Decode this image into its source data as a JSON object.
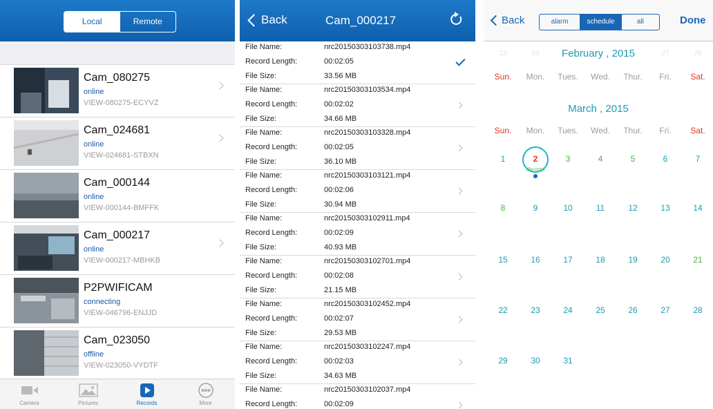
{
  "colors": {
    "nav_blue": "#1a66b6",
    "teal": "#1a9bb3",
    "red": "#d9332a",
    "green": "#3cb83c",
    "gray": "#9a9a9a"
  },
  "screen1": {
    "segment": {
      "local": "Local",
      "remote": "Remote",
      "selected": "Local"
    },
    "cameras": [
      {
        "name": "Cam_080275",
        "status": "online",
        "id": "VIEW-080275-ECYVZ",
        "has_chevron": true
      },
      {
        "name": "Cam_024681",
        "status": "online",
        "id": "VIEW-024681-STBXN",
        "has_chevron": true
      },
      {
        "name": "Cam_000144",
        "status": "online",
        "id": "VIEW-000144-BMFFK",
        "has_chevron": false
      },
      {
        "name": "Cam_000217",
        "status": "online",
        "id": "VIEW-000217-MBHKB",
        "has_chevron": true
      },
      {
        "name": "P2PWIFICAM",
        "status": "connecting",
        "id": "VIEW-046796-ENJJD",
        "has_chevron": false
      },
      {
        "name": "Cam_023050",
        "status": "offline",
        "id": "VIEW-023050-VYDTF",
        "has_chevron": false
      }
    ],
    "tabs": [
      {
        "label": "Camera",
        "icon": "camera-icon"
      },
      {
        "label": "Pictures",
        "icon": "pictures-icon"
      },
      {
        "label": "Records",
        "icon": "records-icon",
        "active": true
      },
      {
        "label": "More",
        "icon": "more-icon"
      }
    ]
  },
  "screen2": {
    "back": "Back",
    "title": "Cam_000217",
    "labels": {
      "file_name": "File Name:",
      "record_length": "Record Length:",
      "file_size": "File Size:"
    },
    "records": [
      {
        "file": "nrc20150303103738.mp4",
        "length": "00:02:05",
        "size": "33.56 MB",
        "checked": true
      },
      {
        "file": "nrc20150303103534.mp4",
        "length": "00:02:02",
        "size": "34.66 MB"
      },
      {
        "file": "nrc20150303103328.mp4",
        "length": "00:02:05",
        "size": "36.10 MB"
      },
      {
        "file": "nrc20150303103121.mp4",
        "length": "00:02:06",
        "size": "30.94 MB"
      },
      {
        "file": "nrc20150303102911.mp4",
        "length": "00:02:09",
        "size": "40.93 MB"
      },
      {
        "file": "nrc20150303102701.mp4",
        "length": "00:02:08",
        "size": "21.15 MB"
      },
      {
        "file": "nrc20150303102452.mp4",
        "length": "00:02:07",
        "size": "29.53 MB"
      },
      {
        "file": "nrc20150303102247.mp4",
        "length": "00:02:03",
        "size": "34.63 MB"
      },
      {
        "file": "nrc20150303102037.mp4",
        "length": "00:02:09",
        "size": ""
      }
    ]
  },
  "screen3": {
    "back": "Back",
    "segments": [
      "alarm",
      "schedule",
      "all"
    ],
    "selected_segment": "schedule",
    "done": "Done",
    "weekdays": [
      "Sun.",
      "Mon.",
      "Tues.",
      "Wed.",
      "Thur.",
      "Fri.",
      "Sat."
    ],
    "feb": {
      "title": "February , 2015",
      "ghost_days": [
        "22",
        "23",
        "",
        "",
        "",
        "27",
        "28"
      ]
    },
    "march": {
      "title": "March , 2015",
      "weeks": [
        [
          "1",
          "2",
          "3",
          "4",
          "5",
          "6",
          "7"
        ],
        [
          "8",
          "9",
          "10",
          "11",
          "12",
          "13",
          "14"
        ],
        [
          "15",
          "16",
          "17",
          "18",
          "19",
          "20",
          "21"
        ],
        [
          "22",
          "23",
          "24",
          "25",
          "26",
          "27",
          "28"
        ],
        [
          "29",
          "30",
          "31",
          "",
          "",
          "",
          ""
        ]
      ],
      "green_days": [
        "3",
        "4",
        "5",
        "8",
        "21"
      ],
      "selected_day": "2",
      "selected_note": "(Records)"
    }
  }
}
